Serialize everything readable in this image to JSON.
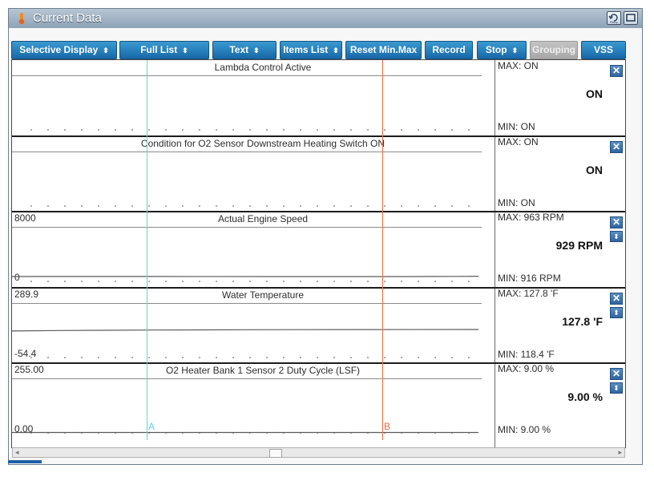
{
  "window": {
    "title": "Current Data",
    "retry_label": "Retry"
  },
  "toolbar": {
    "buttons": [
      {
        "label": "Selective Display",
        "has_arrow": true
      },
      {
        "label": "Full List",
        "has_arrow": true
      },
      {
        "label": "Text",
        "has_arrow": true
      },
      {
        "label": "Items List",
        "has_arrow": true
      },
      {
        "label": "Reset Min.Max",
        "has_arrow": false
      },
      {
        "label": "Record",
        "has_arrow": false
      },
      {
        "label": "Stop",
        "has_arrow": true
      },
      {
        "label": "Grouping",
        "has_arrow": false,
        "disabled": true
      },
      {
        "label": "VSS",
        "has_arrow": false
      }
    ],
    "arrow_glyph": "⬍"
  },
  "panels": [
    {
      "title": "Lambda Control Active",
      "max": "MAX: ON",
      "min": "MIN: ON",
      "value": "ON",
      "scale_top": "",
      "scale_bottom": "",
      "series": [
        [
          0,
          0.15
        ],
        [
          1,
          0.15
        ]
      ]
    },
    {
      "title": "Condition for O2 Sensor Downstream Heating Switch ON",
      "max": "MAX: ON",
      "min": "MIN: ON",
      "value": "ON",
      "scale_top": "",
      "scale_bottom": "",
      "series": [
        [
          0,
          0.15
        ],
        [
          1,
          0.15
        ]
      ]
    },
    {
      "title": "Actual Engine Speed",
      "max": "MAX:   963 RPM",
      "min": "MIN:   916 RPM",
      "value": "929 RPM",
      "scale_top": "8000",
      "scale_bottom": "0",
      "series": [
        [
          0,
          918
        ],
        [
          0.05,
          925
        ],
        [
          0.3,
          922
        ],
        [
          0.55,
          920
        ],
        [
          0.8,
          918
        ],
        [
          0.85,
          915
        ],
        [
          0.9,
          925
        ],
        [
          0.95,
          935
        ],
        [
          1,
          963
        ]
      ]
    },
    {
      "title": "Water Temperature",
      "max": "MAX: 127.8 'F",
      "min": "MIN: 118.4 'F",
      "value": "127.8 'F",
      "scale_top": "289.9",
      "scale_bottom": "-54.4",
      "series": [
        [
          0,
          118.4
        ],
        [
          0.1,
          121
        ],
        [
          0.3,
          124
        ],
        [
          0.5,
          126
        ],
        [
          0.75,
          127
        ],
        [
          1,
          127.8
        ]
      ]
    },
    {
      "title": "O2 Heater Bank 1 Sensor 2 Duty Cycle (LSF)",
      "max": "MAX:  9.00 %",
      "min": "MIN:  9.00 %",
      "value": "9.00 %",
      "scale_top": "255.00",
      "scale_bottom": "0.00",
      "series": [
        [
          0,
          9
        ],
        [
          1,
          9
        ]
      ]
    }
  ],
  "cursors": [
    {
      "label": "A",
      "color": "#5fd3e0"
    },
    {
      "label": "B",
      "color": "#ef6a4a"
    }
  ],
  "panel_controls": {
    "close_glyph": "✕",
    "move_glyph": "⬍"
  }
}
